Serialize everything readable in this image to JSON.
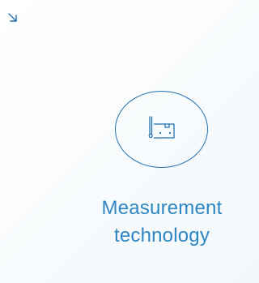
{
  "tile": {
    "title_line1": "Measurement",
    "title_line2": "technology",
    "arrow_icon": "arrow-down-right-icon",
    "category_icon": "measurement-icon",
    "accent_color": "#1f6fae",
    "title_color": "#2c86c5"
  }
}
